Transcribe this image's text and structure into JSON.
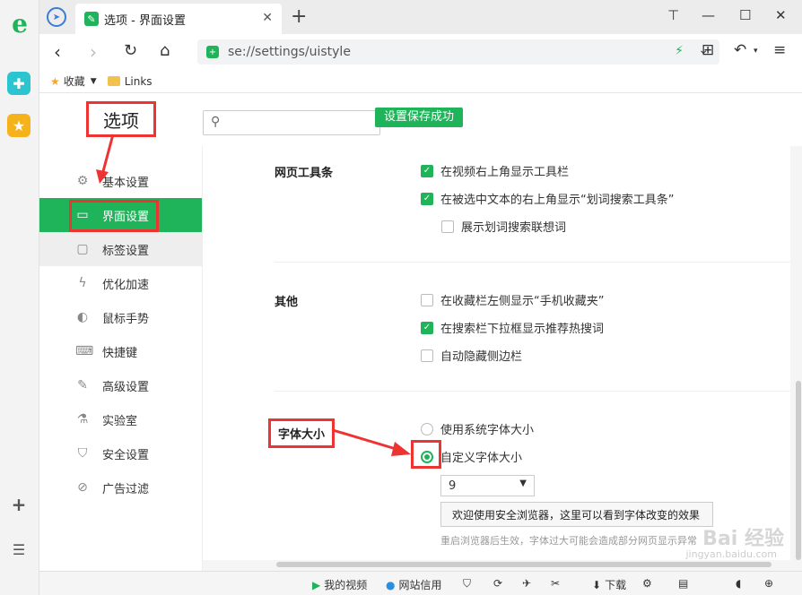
{
  "tab": {
    "title": "选项 - 界面设置",
    "close": "✕",
    "new": "+"
  },
  "window": {
    "pin": "⊤",
    "minimize": "—",
    "maximize": "☐",
    "close": "✕"
  },
  "address": {
    "url": "se://settings/uistyle"
  },
  "bookmarks": {
    "favorites": "收藏",
    "links": "Links"
  },
  "page": {
    "heading": "选项",
    "search_placeholder": "",
    "toast": "设置保存成功"
  },
  "nav": [
    {
      "label": "基本设置",
      "icon": "gear-icon"
    },
    {
      "label": "界面设置",
      "icon": "window-icon"
    },
    {
      "label": "标签设置",
      "icon": "tab-icon"
    },
    {
      "label": "优化加速",
      "icon": "bolt-icon"
    },
    {
      "label": "鼠标手势",
      "icon": "mouse-icon"
    },
    {
      "label": "快捷键",
      "icon": "keyboard-icon"
    },
    {
      "label": "高级设置",
      "icon": "wrench-icon"
    },
    {
      "label": "实验室",
      "icon": "flask-icon"
    },
    {
      "label": "安全设置",
      "icon": "shield-icon"
    },
    {
      "label": "广告过滤",
      "icon": "block-icon"
    }
  ],
  "sections": {
    "toolbar": {
      "title": "网页工具条",
      "options": [
        {
          "label": "在视频右上角显示工具栏",
          "checked": true
        },
        {
          "label": "在被选中文本的右上角显示“划词搜索工具条”",
          "checked": true
        },
        {
          "label": "展示划词搜索联想词",
          "checked": false
        }
      ]
    },
    "other": {
      "title": "其他",
      "options": [
        {
          "label": "在收藏栏左侧显示“手机收藏夹”",
          "checked": false
        },
        {
          "label": "在搜索栏下拉框显示推荐热搜词",
          "checked": true
        },
        {
          "label": "自动隐藏侧边栏",
          "checked": false
        }
      ]
    },
    "font": {
      "title": "字体大小",
      "options": [
        {
          "label": "使用系统字体大小",
          "selected": false
        },
        {
          "label": "自定义字体大小",
          "selected": true
        }
      ],
      "size_value": "9",
      "preview_text": "欢迎使用安全浏览器，这里可以看到字体改变的效果",
      "hint": "重启浏览器后生效，字体过大可能会造成部分网页显示异常"
    }
  },
  "status": {
    "video": "我的视频",
    "site_credit": "网站信用",
    "download": "下载"
  },
  "watermark": {
    "main": "Bai 经验",
    "sub": "jingyan.baidu.com"
  },
  "colors": {
    "accent": "#1fb35a",
    "highlight": "#e33333"
  }
}
